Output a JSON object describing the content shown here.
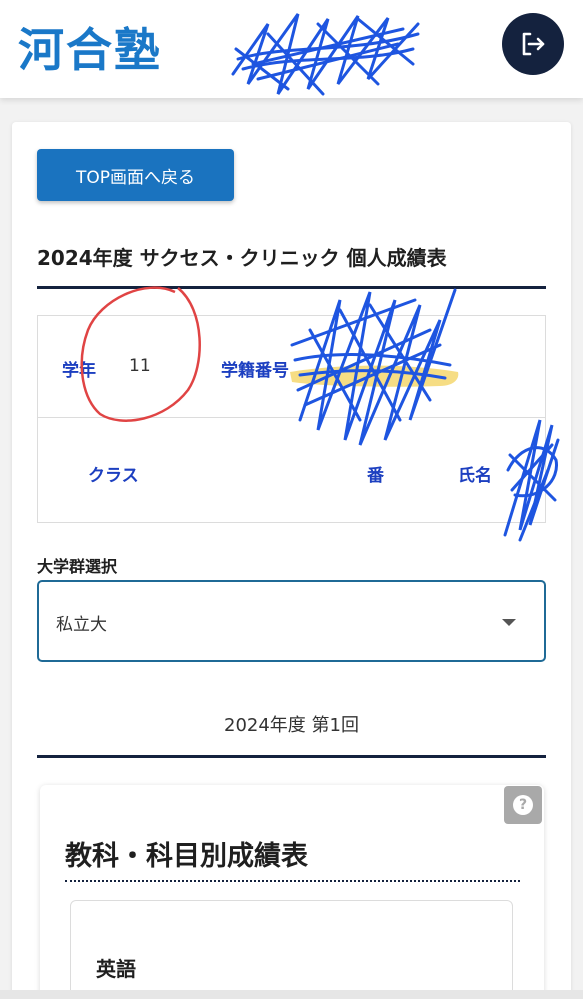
{
  "header": {
    "logo_text": "河合塾",
    "logout_icon": "logout-icon"
  },
  "nav": {
    "top_button_label": "TOP画面へ戻る"
  },
  "report": {
    "title": "2024年度 サクセス・クリニック 個人成績表"
  },
  "student_info": {
    "grade_label": "学年",
    "grade_value": "11",
    "student_id_label": "学籍番号",
    "class_label": "クラス",
    "number_label": "番",
    "name_label": "氏名"
  },
  "university_group": {
    "label": "大学群選択",
    "selected": "私立大"
  },
  "exam": {
    "label": "2024年度 第1回"
  },
  "results": {
    "help_icon": "help-icon",
    "help_glyph": "?",
    "section_title": "教科・科目別成績表",
    "subject": "英語"
  },
  "colors": {
    "brand_blue": "#1a78c8",
    "button_blue": "#1a73bf",
    "navy": "#14223e",
    "label_blue": "#1c3fc0",
    "scribble_blue": "#1e55e0",
    "annotation_red": "#e04444",
    "highlight_yellow": "#f5d76e"
  }
}
